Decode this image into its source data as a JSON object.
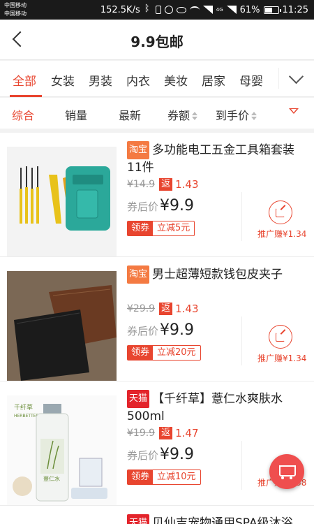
{
  "status_bar": {
    "carrier1": "中国移动",
    "carrier2": "中国移动",
    "speed": "152.5K/s",
    "net_4g": "4G",
    "battery": "61%",
    "battery_level": 0.61,
    "time": "11:25"
  },
  "header": {
    "title": "9.9包邮"
  },
  "categories": [
    "全部",
    "女装",
    "男装",
    "内衣",
    "美妆",
    "居家",
    "母婴"
  ],
  "sort": {
    "items": [
      "综合",
      "销量",
      "最新",
      "券额",
      "到手价"
    ]
  },
  "products": [
    {
      "platform": "淘宝",
      "title": "多功能电工五金工具箱套装11件",
      "orig_price": "¥14.9",
      "rebate_tag": "返",
      "rebate": "1.43",
      "after_label": "券后价",
      "after_price": "¥9.9",
      "coupon_label": "领券",
      "coupon_text": "立减5元",
      "share_label": "推广赚¥1.34"
    },
    {
      "platform": "淘宝",
      "title": "男士超薄短款钱包皮夹子",
      "orig_price": "¥29.9",
      "rebate_tag": "返",
      "rebate": "1.43",
      "after_label": "券后价",
      "after_price": "¥9.9",
      "coupon_label": "领券",
      "coupon_text": "立减20元",
      "share_label": "推广赚¥1.34"
    },
    {
      "platform": "天猫",
      "title": "【千纤草】薏仁水爽肤水500ml",
      "orig_price": "¥19.9",
      "rebate_tag": "返",
      "rebate": "1.47",
      "after_label": "券后价",
      "after_price": "¥9.9",
      "coupon_label": "领券",
      "coupon_text": "立减10元",
      "share_label": "推广赚¥1.38",
      "brand": "千纤草",
      "brand_en": "HERBETTER",
      "label_cn": "薏仁水"
    },
    {
      "platform": "天猫",
      "title": "贝仙吉宠物通用SPA级沐浴露"
    }
  ],
  "colors": {
    "accent": "#e8452f",
    "taobao": "#f47a42",
    "tmall": "#e3242b"
  }
}
